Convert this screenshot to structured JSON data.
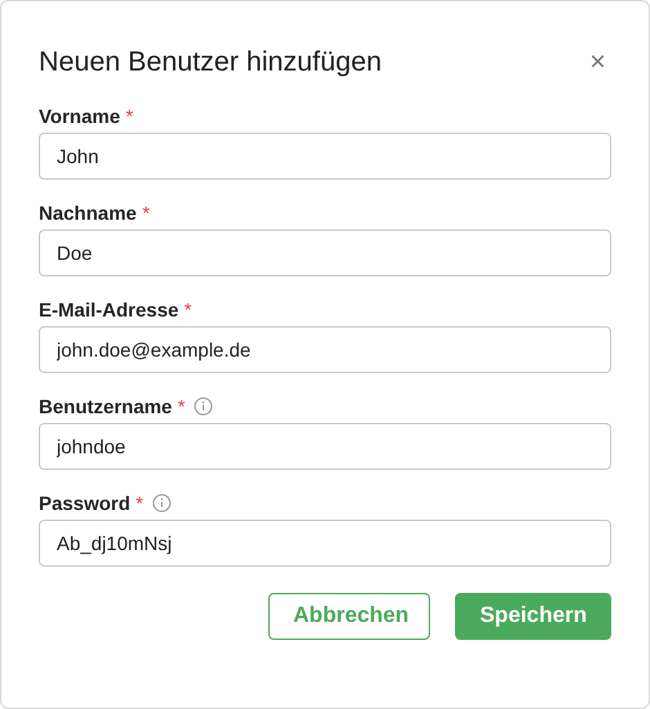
{
  "dialog": {
    "title": "Neuen Benutzer hinzufügen",
    "close": "×"
  },
  "fields": [
    {
      "label": "Vorname",
      "required_mark": "*",
      "info": false,
      "value": "John"
    },
    {
      "label": "Nachname",
      "required_mark": "*",
      "info": false,
      "value": "Doe"
    },
    {
      "label": "E-Mail-Adresse",
      "required_mark": "*",
      "info": false,
      "value": "john.doe@example.de"
    },
    {
      "label": "Benutzername",
      "required_mark": "*",
      "info": true,
      "value": "johndoe"
    },
    {
      "label": "Password",
      "required_mark": "*",
      "info": true,
      "value": "Ab_dj10mNsj"
    }
  ],
  "buttons": [
    {
      "label": "Abbrechen",
      "kind": "secondary"
    },
    {
      "label": "Speichern",
      "kind": "primary"
    }
  ]
}
